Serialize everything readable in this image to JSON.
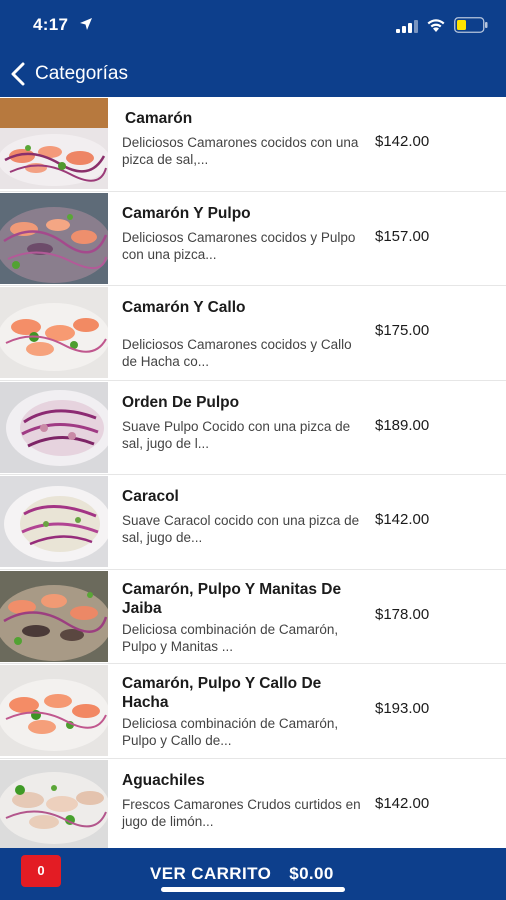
{
  "status_bar": {
    "time": "4:17"
  },
  "nav": {
    "back_label": "Categorías"
  },
  "items": [
    {
      "title": "Camarón",
      "description": "Deliciosos Camarones cocidos con una pizca de sal,...",
      "price": "$142.00"
    },
    {
      "title": "Camarón Y Pulpo",
      "description": "Deliciosos Camarones cocidos y Pulpo con una pizca...",
      "price": "$157.00"
    },
    {
      "title": "Camarón Y Callo",
      "description": "Deliciosos Camarones cocidos y Callo de Hacha co...",
      "price": "$175.00"
    },
    {
      "title": "Orden De Pulpo",
      "description": "Suave Pulpo Cocido con una pizca de sal, jugo de l...",
      "price": "$189.00"
    },
    {
      "title": "Caracol",
      "description": "Suave Caracol cocido con una pizca de sal, jugo de...",
      "price": "$142.00"
    },
    {
      "title": "Camarón, Pulpo Y Manitas De Jaiba",
      "description": "Deliciosa combinación de Camarón, Pulpo y Manitas ...",
      "price": "$178.00"
    },
    {
      "title": "Camarón, Pulpo Y Callo De Hacha",
      "description": "Deliciosa combinación de Camarón, Pulpo y Callo de...",
      "price": "$193.00"
    },
    {
      "title": "Aguachiles",
      "description": "Frescos Camarones Crudos curtidos en jugo de limón...",
      "price": "$142.00"
    }
  ],
  "cart": {
    "count": "0",
    "label": "VER CARRITO",
    "total": "$0.00"
  },
  "colors": {
    "bar": "#0d3f8c",
    "cart_badge": "#e31c24"
  },
  "icons": [
    "location-arrow-icon",
    "signal-icon",
    "wifi-icon",
    "battery-icon",
    "back-chevron-icon"
  ]
}
